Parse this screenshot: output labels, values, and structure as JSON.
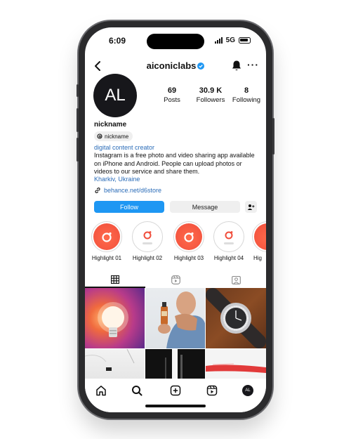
{
  "status_bar": {
    "time": "6:09",
    "network": "5G"
  },
  "header": {
    "username": "aiconiclabs",
    "more": "···"
  },
  "profile": {
    "avatar_initials": "AL",
    "stats": [
      {
        "value": "69",
        "label": "Posts"
      },
      {
        "value": "30.9 K",
        "label": "Followers"
      },
      {
        "value": "8",
        "label": "Following"
      }
    ],
    "name": "nickname",
    "threads_handle": "nickname",
    "category": "digital content creator",
    "bio": "Instagram is a free photo and video sharing app available on iPhone and Android. People can upload photos or videos to our service and share them.",
    "location": "Kharkiv, Ukraine",
    "link": "behance.net/d6store"
  },
  "actions": {
    "follow": "Follow",
    "message": "Message"
  },
  "highlights": [
    {
      "label": "Highlight 01",
      "style": "orange"
    },
    {
      "label": "Highlight 02",
      "style": "white"
    },
    {
      "label": "Highlight 03",
      "style": "orange"
    },
    {
      "label": "Highlight 04",
      "style": "white"
    },
    {
      "label": "Hig",
      "style": "orange"
    }
  ],
  "tabs": [
    "grid-icon",
    "reels-icon",
    "tagged-icon"
  ],
  "bottom_nav": {
    "avatar_initials": "AL"
  },
  "colors": {
    "accent": "#1e97f3",
    "link": "#2a6cb8",
    "highlight_orange": "#f04d3b"
  }
}
